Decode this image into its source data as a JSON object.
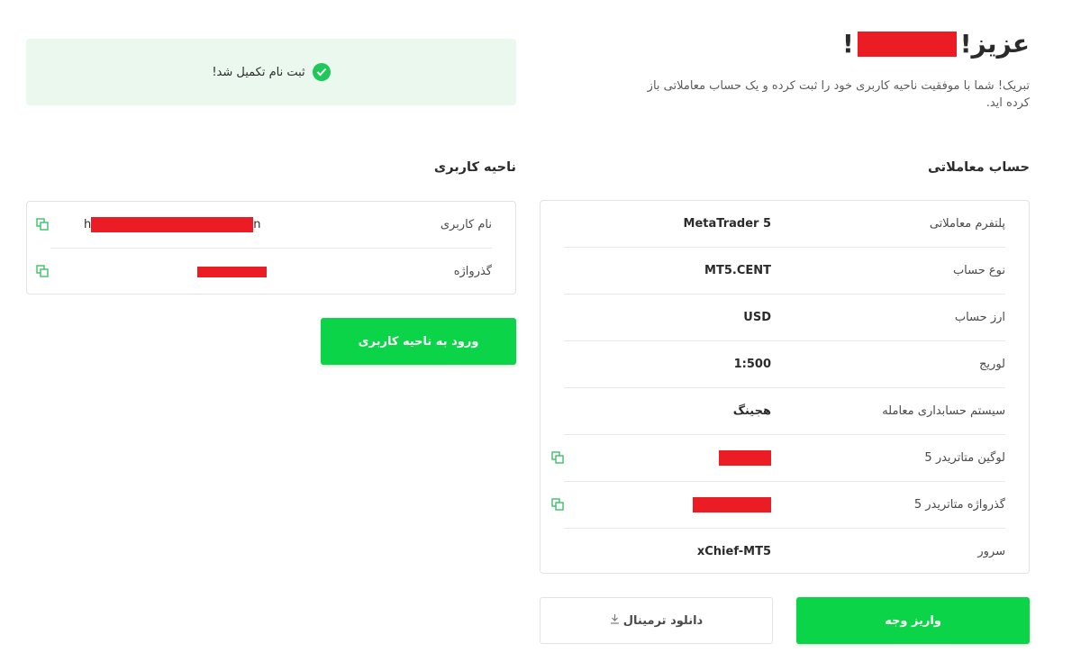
{
  "header": {
    "greeting_prefix": "عزیز!",
    "greeting_suffix": "!",
    "intro": "تبریک! شما با موفقیت ناحیه کاربری خود را ثبت کرده و یک حساب معاملاتی باز کرده اید."
  },
  "banner": {
    "text": "ثبت نام تکمیل شد!"
  },
  "trading_account": {
    "title": "حساب معاملاتی",
    "rows": [
      {
        "label": "پلتفرم معاملاتی",
        "value": "MetaTrader 5"
      },
      {
        "label": "نوع حساب",
        "value": "MT5.CENT"
      },
      {
        "label": "ارز حساب",
        "value": "USD"
      },
      {
        "label": "لوریج",
        "value": "1:500"
      },
      {
        "label": "سیستم حسابداری معامله",
        "value": "هجینگ"
      },
      {
        "label": "لوگین متاتریدر 5",
        "value": ""
      },
      {
        "label": "گذرواژه متاتریدر 5",
        "value": ""
      },
      {
        "label": "سرور",
        "value": "xChief-MT5"
      }
    ],
    "deposit_button": "واریز وجه",
    "download_button": "دانلود ترمینال"
  },
  "user_area": {
    "title": "ناحیه کاربری",
    "rows": [
      {
        "label": "نام کاربری",
        "value_start": "h",
        "value_end": "n"
      },
      {
        "label": "گذرواژه",
        "value": ""
      }
    ],
    "login_button": "ورود به ناحیه کاربری"
  },
  "colors": {
    "accent": "#0cd448",
    "banner_bg": "#eaf8ed",
    "redaction": "#ec1c24"
  },
  "icons": {
    "copy": "copy-icon",
    "check": "check-circle-icon",
    "download": "download-arrow-icon"
  }
}
